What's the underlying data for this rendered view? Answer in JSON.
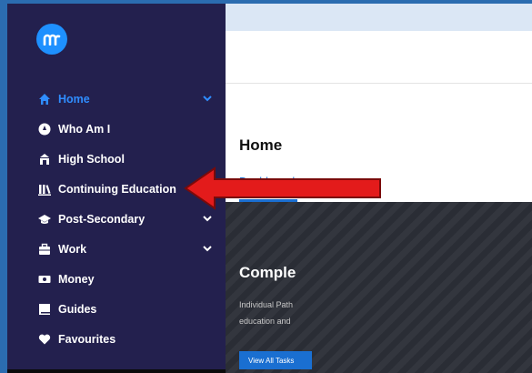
{
  "colors": {
    "sidebar_bg": "#23204e",
    "accent": "#2f8dff",
    "arrow": "#e31b1b",
    "logo": "#1e90ff"
  },
  "sidebar": {
    "logo_icon": "mykey-logo",
    "items": [
      {
        "label": "Home",
        "icon": "home-icon",
        "active": true,
        "has_chevron": true
      },
      {
        "label": "Who Am I",
        "icon": "compass-icon",
        "active": false,
        "has_chevron": false
      },
      {
        "label": "High School",
        "icon": "school-icon",
        "active": false,
        "has_chevron": false
      },
      {
        "label": "Continuing Education",
        "icon": "library-icon",
        "active": false,
        "has_chevron": false
      },
      {
        "label": "Post-Secondary",
        "icon": "graduation-cap-icon",
        "active": false,
        "has_chevron": true
      },
      {
        "label": "Work",
        "icon": "briefcase-icon",
        "active": false,
        "has_chevron": true
      },
      {
        "label": "Money",
        "icon": "money-icon",
        "active": false,
        "has_chevron": false
      },
      {
        "label": "Guides",
        "icon": "book-icon",
        "active": false,
        "has_chevron": false
      },
      {
        "label": "Favourites",
        "icon": "heart-icon",
        "active": false,
        "has_chevron": false
      }
    ]
  },
  "main": {
    "title": "Home",
    "tabs": [
      {
        "label": "Dashboard",
        "active": true
      }
    ],
    "hero": {
      "title": "Comple",
      "line1": "Individual Path",
      "line2": "education and",
      "button_label": "View All Tasks"
    }
  },
  "annotation": {
    "type": "red-arrow",
    "points_to": "Continuing Education"
  }
}
